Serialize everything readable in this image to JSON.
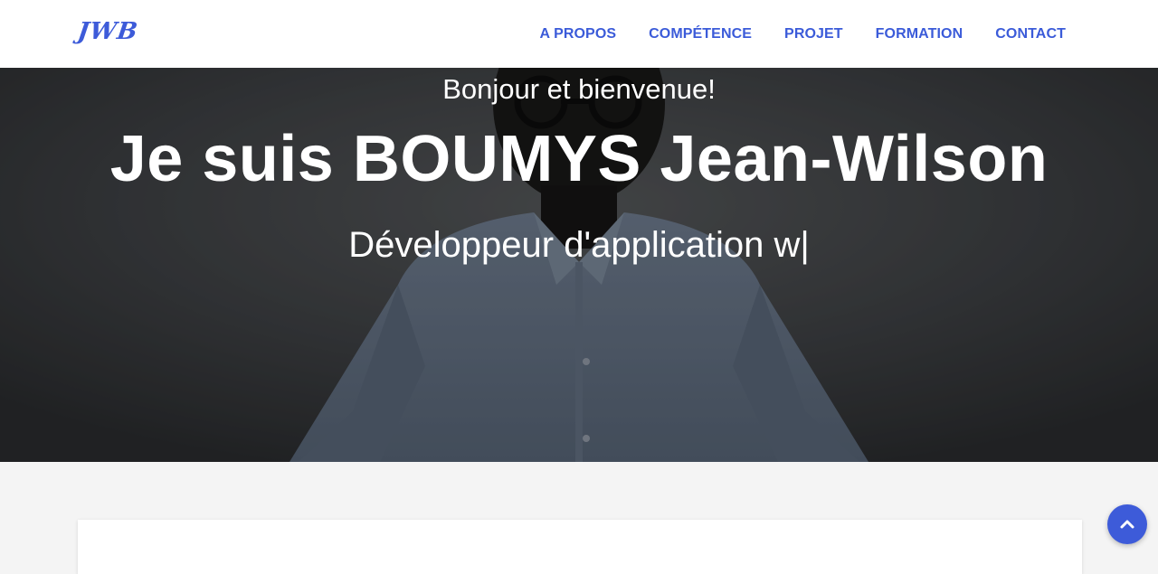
{
  "brand": {
    "logo_text": "JWB",
    "accent_color": "#3d5bd9"
  },
  "nav": {
    "items": [
      {
        "label": "A PROPOS"
      },
      {
        "label": "COMPÉTENCE"
      },
      {
        "label": "PROJET"
      },
      {
        "label": "FORMATION"
      },
      {
        "label": "CONTACT"
      }
    ]
  },
  "hero": {
    "greeting": "Bonjour et bienvenue!",
    "name": "Je suis BOUMYS Jean-Wilson",
    "role": "Développeur d'application w|"
  },
  "scroll_top": {
    "icon": "chevron-up-icon"
  }
}
